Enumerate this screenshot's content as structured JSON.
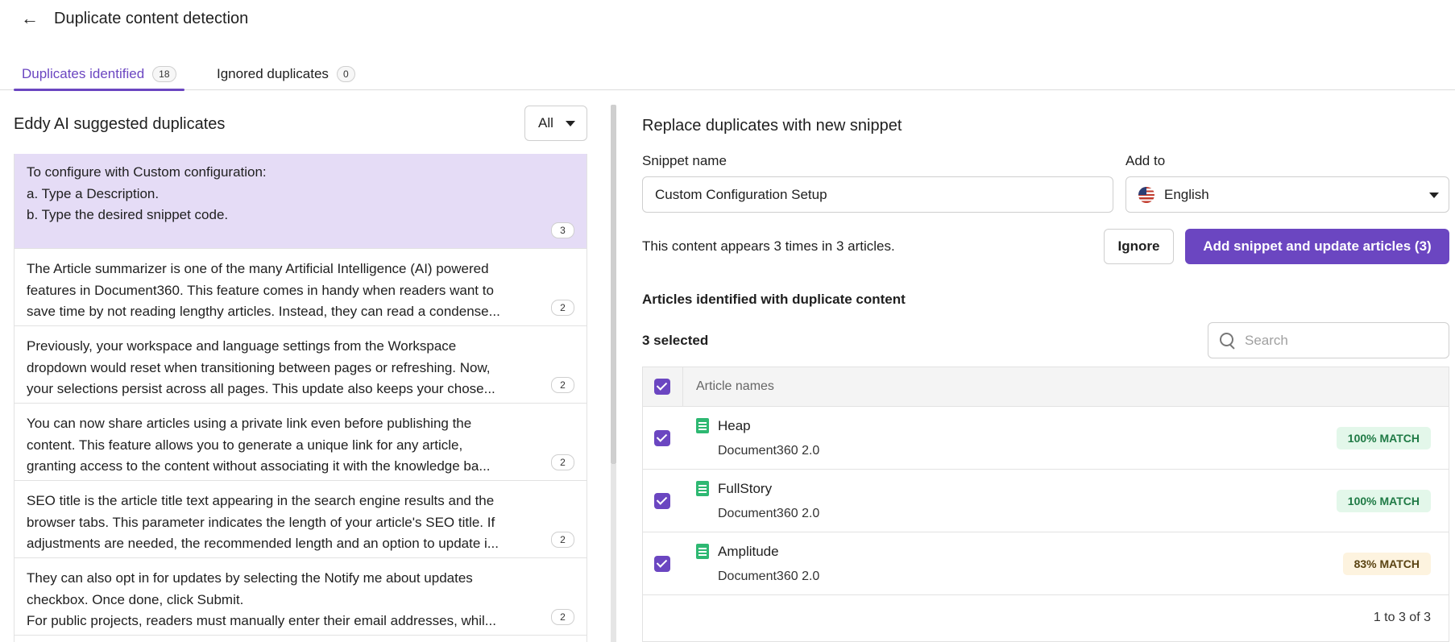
{
  "header": {
    "back_icon": "arrow-left-icon",
    "title": "Duplicate content detection"
  },
  "tabs": [
    {
      "label": "Duplicates identified",
      "count": "18",
      "active": true
    },
    {
      "label": "Ignored duplicates",
      "count": "0",
      "active": false
    }
  ],
  "left": {
    "title": "Eddy AI suggested duplicates",
    "filter": {
      "value": "All"
    },
    "items": [
      {
        "lines": [
          "To configure with Custom configuration:",
          "a. Type a Description.",
          "b. Type the desired snippet code."
        ],
        "count": "3",
        "selected": true
      },
      {
        "lines": [
          "The Article summarizer is one of the many Artificial Intelligence (AI) powered",
          "features in Document360. This feature comes in handy when readers want to",
          "save time by not reading lengthy articles. Instead, they can read a condense..."
        ],
        "count": "2"
      },
      {
        "lines": [
          "Previously, your workspace and language settings from the Workspace",
          "dropdown would reset when transitioning between pages or refreshing. Now,",
          "your selections persist across all pages. This update also keeps your chose..."
        ],
        "count": "2"
      },
      {
        "lines": [
          "You can now share articles using a private link even before publishing the",
          "content. This feature allows you to generate a unique link for any article,",
          "granting access to the content without associating it with the knowledge ba..."
        ],
        "count": "2"
      },
      {
        "lines": [
          "SEO title is the article title text appearing in the search engine results and the",
          "browser tabs. This parameter indicates the length of your article's SEO title. If",
          "adjustments are needed, the recommended length and an option to update i..."
        ],
        "count": "2"
      },
      {
        "lines": [
          "They can also opt in for updates by selecting the Notify me about updates",
          "checkbox. Once done, click Submit.",
          "For public projects, readers must manually enter their email addresses, whil..."
        ],
        "count": "2"
      }
    ]
  },
  "right": {
    "title": "Replace duplicates with new snippet",
    "snippet_name_label": "Snippet name",
    "snippet_name_value": "Custom Configuration Setup",
    "add_to_label": "Add to",
    "add_to_value": "English",
    "appears_text": "This content appears 3 times in 3 articles.",
    "ignore_label": "Ignore",
    "add_label": "Add snippet and update articles (3)",
    "articles_heading": "Articles identified with duplicate content",
    "selected_text": "3 selected",
    "search_placeholder": "Search",
    "table": {
      "column_header": "Article names",
      "rows": [
        {
          "name": "Heap",
          "project": "Document360 2.0",
          "match": "100% MATCH",
          "match_type": "full"
        },
        {
          "name": "FullStory",
          "project": "Document360 2.0",
          "match": "100% MATCH",
          "match_type": "full"
        },
        {
          "name": "Amplitude",
          "project": "Document360 2.0",
          "match": "83% MATCH",
          "match_type": "partial"
        }
      ],
      "pagination": "1 to 3 of 3"
    }
  },
  "colors": {
    "accent": "#6b46c1",
    "selected_bg": "#e5dcf6",
    "match_full_bg": "#e3f7ea",
    "match_partial_bg": "#fdf3df"
  }
}
